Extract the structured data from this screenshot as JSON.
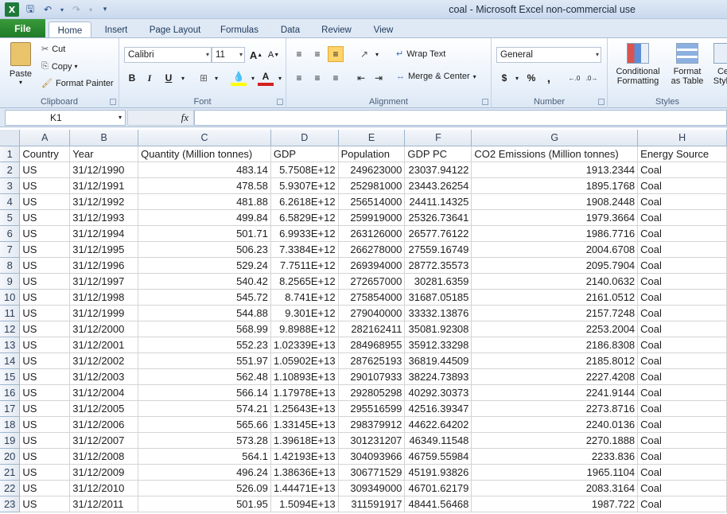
{
  "window": {
    "title": "coal  -  Microsoft Excel non-commercial use"
  },
  "quick_access": [
    "save-icon",
    "undo-icon",
    "redo-icon",
    "customize-icon"
  ],
  "tabs": {
    "file": "File",
    "home": "Home",
    "insert": "Insert",
    "page_layout": "Page Layout",
    "formulas": "Formulas",
    "data": "Data",
    "review": "Review",
    "view": "View"
  },
  "ribbon": {
    "clipboard": {
      "label": "Clipboard",
      "paste": "Paste",
      "cut": "Cut",
      "copy": "Copy",
      "format_painter": "Format Painter"
    },
    "font": {
      "label": "Font",
      "name": "Calibri",
      "size": "11",
      "bold": "B",
      "italic": "I",
      "underline": "U"
    },
    "alignment": {
      "label": "Alignment",
      "wrap_text": "Wrap Text",
      "merge_center": "Merge & Center"
    },
    "number": {
      "label": "Number",
      "format": "General",
      "currency": "$",
      "percent": "%",
      "comma": ","
    },
    "styles": {
      "label": "Styles",
      "conditional": "Conditional",
      "conditional2": "Formatting",
      "format_as": "Format",
      "format_as2": "as Table",
      "cell": "Ce",
      "cell2": "Style"
    }
  },
  "formula_bar": {
    "name_box": "K1",
    "fx": "fx",
    "value": ""
  },
  "columns": [
    "A",
    "B",
    "C",
    "D",
    "E",
    "F",
    "G",
    "H"
  ],
  "rows": [
    [
      "Country",
      "Year",
      "Quantity (Million tonnes)",
      "GDP",
      "Population",
      "GDP PC",
      "CO2 Emissions (Million tonnes)",
      "Energy Source"
    ],
    [
      "US",
      "31/12/1990",
      "483.14",
      "5.7508E+12",
      "249623000",
      "23037.94122",
      "1913.2344",
      "Coal"
    ],
    [
      "US",
      "31/12/1991",
      "478.58",
      "5.9307E+12",
      "252981000",
      "23443.26254",
      "1895.1768",
      "Coal"
    ],
    [
      "US",
      "31/12/1992",
      "481.88",
      "6.2618E+12",
      "256514000",
      "24411.14325",
      "1908.2448",
      "Coal"
    ],
    [
      "US",
      "31/12/1993",
      "499.84",
      "6.5829E+12",
      "259919000",
      "25326.73641",
      "1979.3664",
      "Coal"
    ],
    [
      "US",
      "31/12/1994",
      "501.71",
      "6.9933E+12",
      "263126000",
      "26577.76122",
      "1986.7716",
      "Coal"
    ],
    [
      "US",
      "31/12/1995",
      "506.23",
      "7.3384E+12",
      "266278000",
      "27559.16749",
      "2004.6708",
      "Coal"
    ],
    [
      "US",
      "31/12/1996",
      "529.24",
      "7.7511E+12",
      "269394000",
      "28772.35573",
      "2095.7904",
      "Coal"
    ],
    [
      "US",
      "31/12/1997",
      "540.42",
      "8.2565E+12",
      "272657000",
      "30281.6359",
      "2140.0632",
      "Coal"
    ],
    [
      "US",
      "31/12/1998",
      "545.72",
      "8.741E+12",
      "275854000",
      "31687.05185",
      "2161.0512",
      "Coal"
    ],
    [
      "US",
      "31/12/1999",
      "544.88",
      "9.301E+12",
      "279040000",
      "33332.13876",
      "2157.7248",
      "Coal"
    ],
    [
      "US",
      "31/12/2000",
      "568.99",
      "9.8988E+12",
      "282162411",
      "35081.92308",
      "2253.2004",
      "Coal"
    ],
    [
      "US",
      "31/12/2001",
      "552.23",
      "1.02339E+13",
      "284968955",
      "35912.33298",
      "2186.8308",
      "Coal"
    ],
    [
      "US",
      "31/12/2002",
      "551.97",
      "1.05902E+13",
      "287625193",
      "36819.44509",
      "2185.8012",
      "Coal"
    ],
    [
      "US",
      "31/12/2003",
      "562.48",
      "1.10893E+13",
      "290107933",
      "38224.73893",
      "2227.4208",
      "Coal"
    ],
    [
      "US",
      "31/12/2004",
      "566.14",
      "1.17978E+13",
      "292805298",
      "40292.30373",
      "2241.9144",
      "Coal"
    ],
    [
      "US",
      "31/12/2005",
      "574.21",
      "1.25643E+13",
      "295516599",
      "42516.39347",
      "2273.8716",
      "Coal"
    ],
    [
      "US",
      "31/12/2006",
      "565.66",
      "1.33145E+13",
      "298379912",
      "44622.64202",
      "2240.0136",
      "Coal"
    ],
    [
      "US",
      "31/12/2007",
      "573.28",
      "1.39618E+13",
      "301231207",
      "46349.11548",
      "2270.1888",
      "Coal"
    ],
    [
      "US",
      "31/12/2008",
      "564.1",
      "1.42193E+13",
      "304093966",
      "46759.55984",
      "2233.836",
      "Coal"
    ],
    [
      "US",
      "31/12/2009",
      "496.24",
      "1.38636E+13",
      "306771529",
      "45191.93826",
      "1965.1104",
      "Coal"
    ],
    [
      "US",
      "31/12/2010",
      "526.09",
      "1.44471E+13",
      "309349000",
      "46701.62179",
      "2083.3164",
      "Coal"
    ],
    [
      "US",
      "31/12/2011",
      "501.95",
      "1.5094E+13",
      "311591917",
      "48441.56468",
      "1987.722",
      "Coal"
    ]
  ]
}
